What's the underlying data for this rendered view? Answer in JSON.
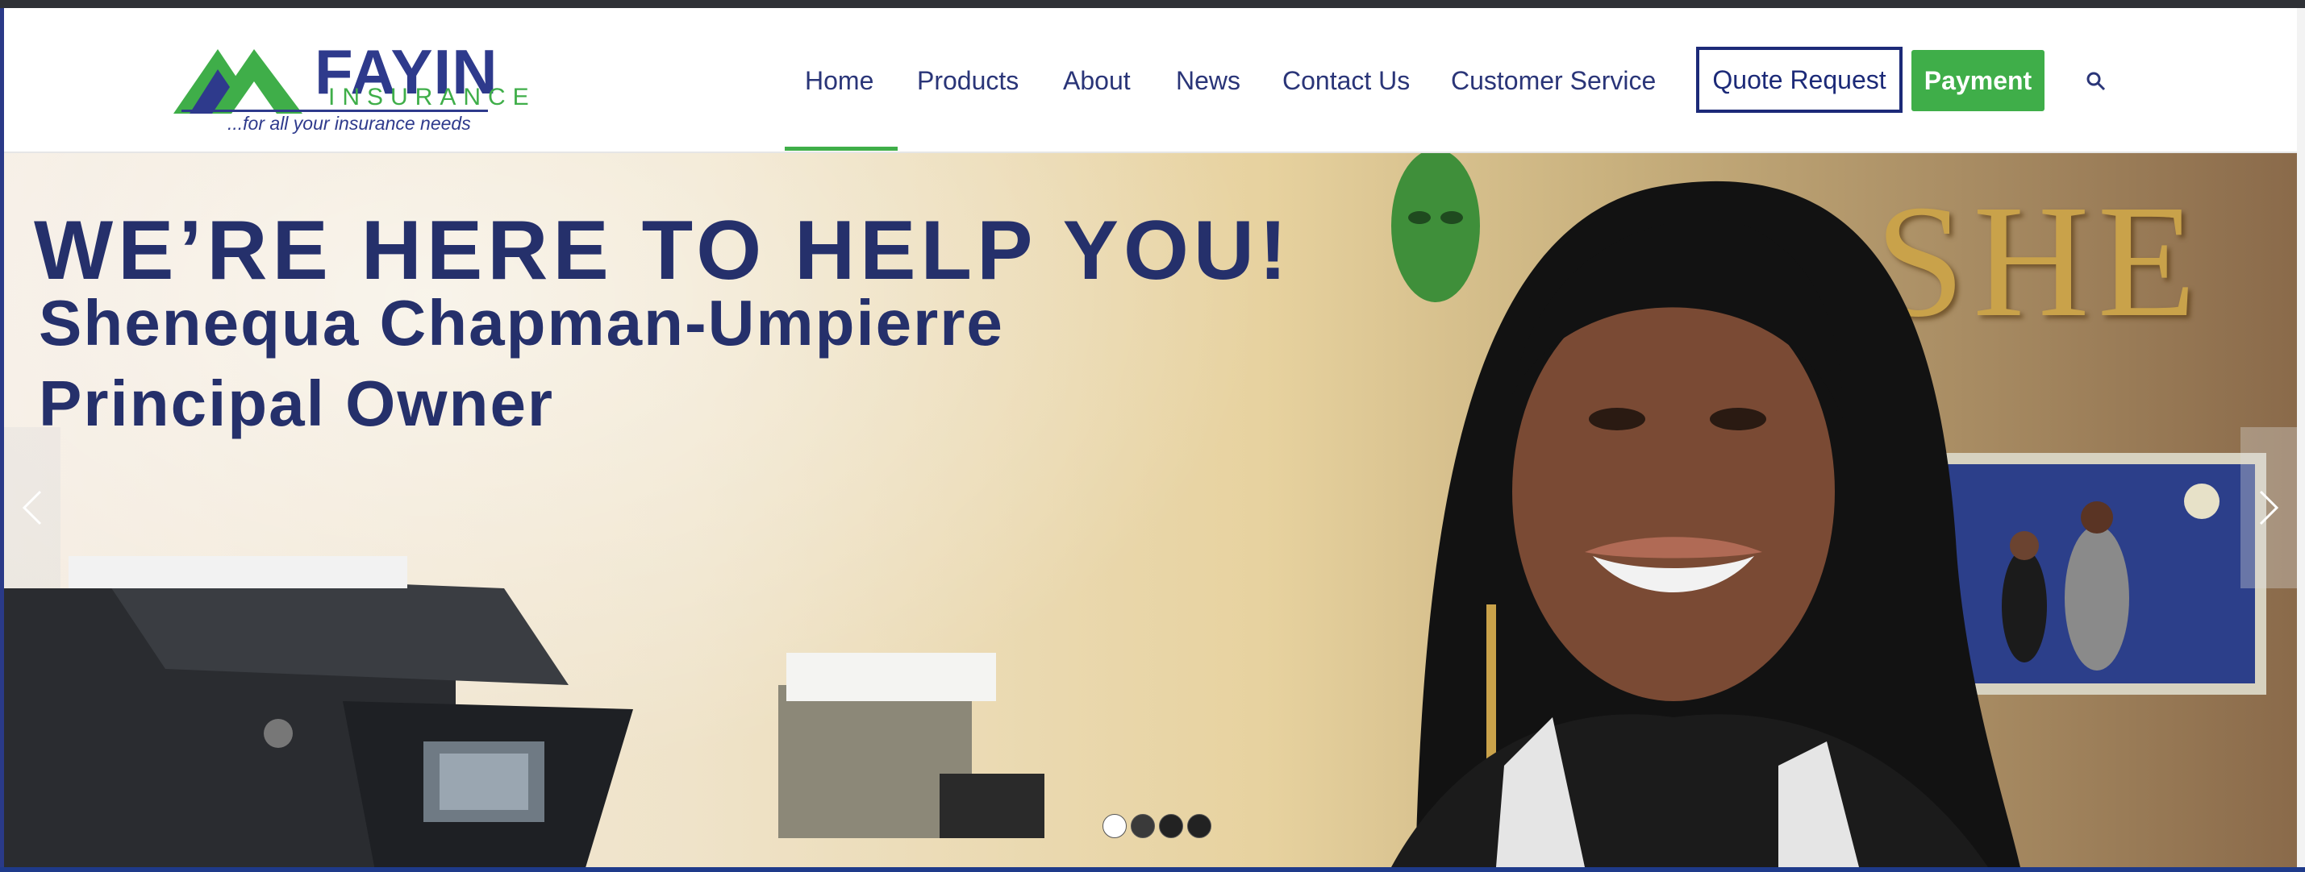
{
  "logo": {
    "name": "FAYIN",
    "subname": "INSURANCE",
    "tagline": "...for all your insurance needs"
  },
  "nav": {
    "items": [
      {
        "label": "Home",
        "active": true
      },
      {
        "label": "Products"
      },
      {
        "label": "About"
      },
      {
        "label": "News"
      },
      {
        "label": "Contact Us"
      },
      {
        "label": "Customer Service"
      }
    ],
    "quote_label": "Quote Request",
    "payment_label": "Payment",
    "search_icon": "search-icon"
  },
  "hero": {
    "headline": "WE’RE HERE TO HELP YOU!",
    "name": "Shenequa Chapman-Umpierre",
    "role": "Principal Owner",
    "wall_letters": "SHE",
    "slides": 4,
    "active_slide": 1
  },
  "colors": {
    "brand_blue": "#2e3a8c",
    "brand_green": "#3fae49",
    "text_navy": "#25306b"
  }
}
